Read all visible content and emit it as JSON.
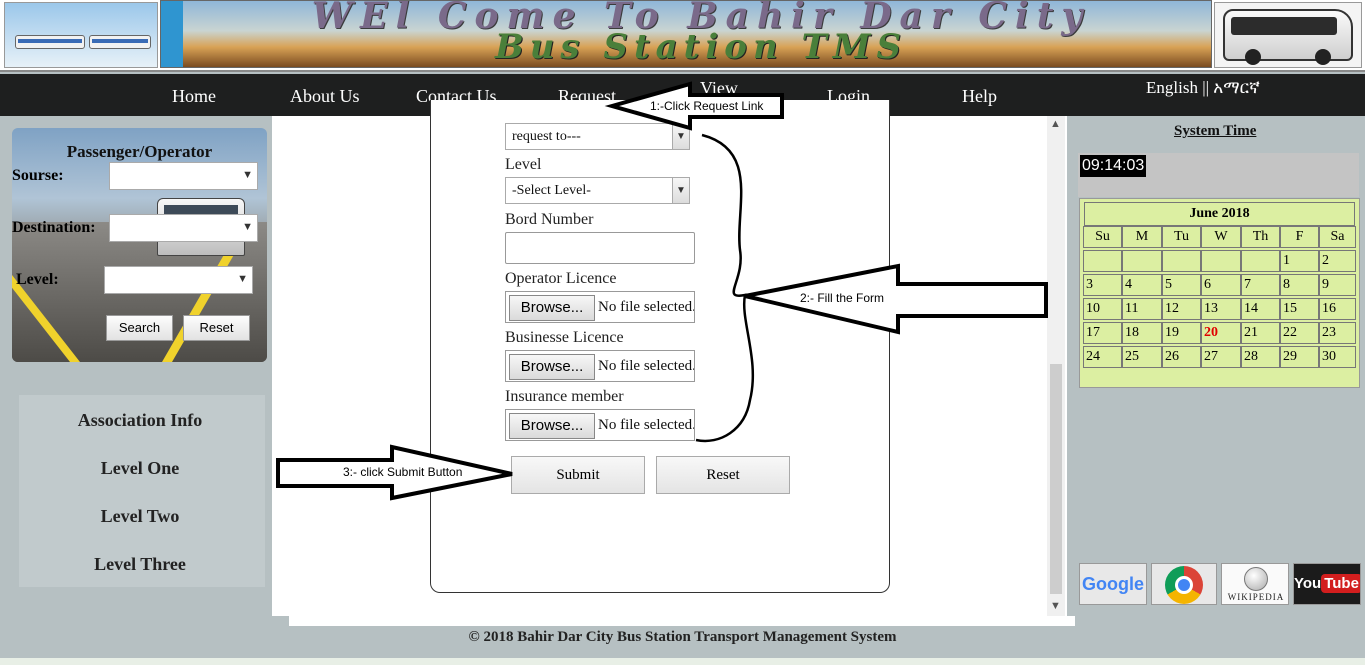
{
  "header": {
    "title_line1": "WEl Come To Bahir Dar City",
    "title_line2": "Bus Station TMS"
  },
  "nav": {
    "items": [
      "Home",
      "About Us",
      "Contact Us",
      "Request",
      "View",
      "Login",
      "Help"
    ],
    "language": "English  || አማርኛ"
  },
  "search_panel": {
    "title": "Passenger/Operator",
    "source_label": "Sourse:",
    "destination_label": "Destination:",
    "level_label": "Level:",
    "search_button": "Search",
    "reset_button": "Reset"
  },
  "association": {
    "items": [
      "Association Info",
      "Level One",
      "Level Two",
      "Level Three"
    ]
  },
  "form": {
    "request_to_value": "request to---",
    "level_label": "Level",
    "level_value": "-Select Level-",
    "bord_label": "Bord Number",
    "operator_licence_label": "Operator Licence",
    "business_licence_label": "Businesse Licence",
    "insurance_label": "Insurance member",
    "browse_label": "Browse...",
    "no_file_text": "No file selected.",
    "submit_button": "Submit",
    "reset_button": "Reset"
  },
  "annotations": {
    "step1": "1:-Click Request Link",
    "step2": "2:- Fill the Form",
    "step3": "3:- click Submit Button"
  },
  "system_time": {
    "label": "System Time",
    "value": "09:14:03"
  },
  "calendar": {
    "title": "June 2018",
    "weekdays": [
      "Su",
      "M",
      "Tu",
      "W",
      "Th",
      "F",
      "Sa"
    ],
    "weeks": [
      [
        "",
        "",
        "",
        "",
        "",
        "1",
        "2"
      ],
      [
        "3",
        "4",
        "5",
        "6",
        "7",
        "8",
        "9"
      ],
      [
        "10",
        "11",
        "12",
        "13",
        "14",
        "15",
        "16"
      ],
      [
        "17",
        "18",
        "19",
        "20",
        "21",
        "22",
        "23"
      ],
      [
        "24",
        "25",
        "26",
        "27",
        "28",
        "29",
        "30"
      ]
    ],
    "today": "20",
    "today_color": "#e00000"
  },
  "links": {
    "google": "Google",
    "wikipedia": "WIKIPEDIA",
    "youtube_you": "You",
    "youtube_tube": "Tube"
  },
  "footer": {
    "text": "© 2018 Bahir Dar City Bus Station Transport Management System"
  }
}
